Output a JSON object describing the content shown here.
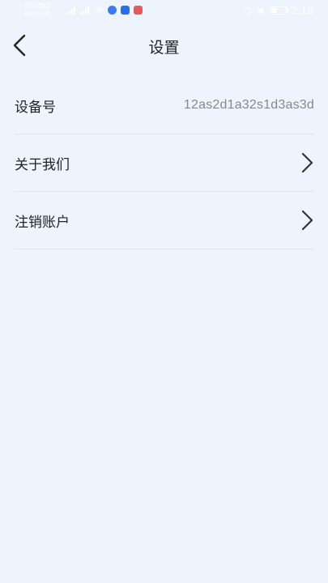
{
  "status_bar": {
    "carrier_line1": "中国电信",
    "carrier_line2": "中国移动",
    "time": "2:18",
    "icons": [
      "signal-icon",
      "wifi-icon",
      "app-notification-icon",
      "battery-icon",
      "alarm-icon",
      "mute-icon"
    ]
  },
  "header": {
    "back_icon": "chevron-left-icon",
    "title": "设置"
  },
  "settings": {
    "device_id_label": "设备号",
    "device_id_value": "12as2d1a32s1d3as3d",
    "about_label": "关于我们",
    "cancel_account_label": "注销账户",
    "row_icon": "chevron-right-icon"
  },
  "colors": {
    "background": "#edf4fd",
    "divider": "#dde5ee",
    "text": "#222222",
    "value_text": "#888888"
  }
}
